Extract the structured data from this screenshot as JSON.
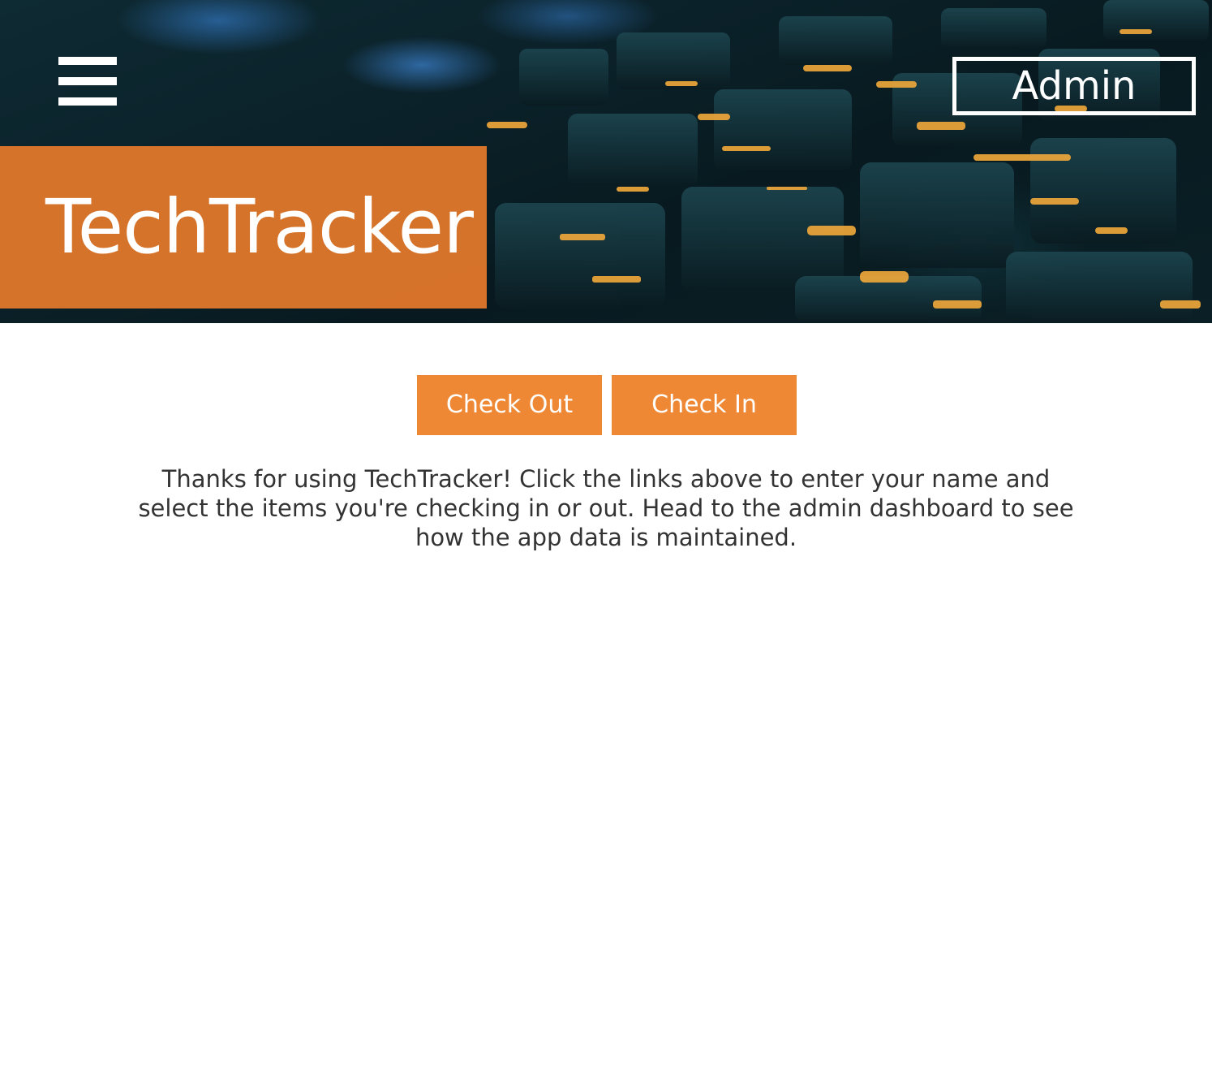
{
  "header": {
    "menu_icon": "hamburger-menu-icon",
    "admin_label": "Admin",
    "title": "TechTracker",
    "background_image": "keyboard-photo",
    "accent_color": "#e67a2b"
  },
  "actions": {
    "check_out_label": "Check Out",
    "check_in_label": "Check In",
    "button_color": "#ef8835"
  },
  "main": {
    "intro_text": "Thanks for using TechTracker! Click the links above to enter your name and select the items you're checking in or out. Head to the admin dashboard to see how the app data is maintained."
  }
}
